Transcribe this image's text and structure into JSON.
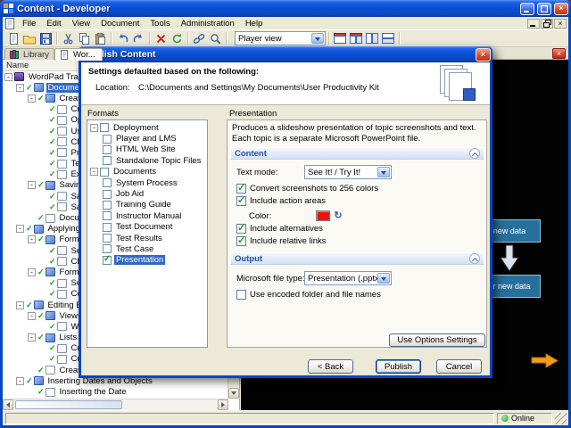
{
  "window": {
    "title": "Content - Developer",
    "titlebar_buttons": {
      "minimize": "minimize",
      "maximize": "maximize",
      "close": "close"
    },
    "menu": [
      "File",
      "Edit",
      "View",
      "Document",
      "Tools",
      "Administration",
      "Help"
    ],
    "toolbar": {
      "items": [
        "new-document",
        "open",
        "save",
        "|",
        "cut",
        "copy",
        "paste",
        "|",
        "undo",
        "redo",
        "|",
        "delete",
        "refresh",
        "|",
        "link",
        "find",
        "|"
      ],
      "view_combo": "Player view",
      "view_buttons": [
        "layout-player",
        "layout-split",
        "layout-columns",
        "layout-rows"
      ]
    },
    "status": {
      "online_label": "Online"
    }
  },
  "library": {
    "tabs": [
      {
        "label": "Library",
        "active": false
      },
      {
        "label": "Wor...",
        "active": true
      }
    ],
    "column_header": "Name",
    "tree": [
      {
        "d": 0,
        "label": "WordPad Training",
        "icon": "book",
        "check": false,
        "parent": true,
        "sel": false
      },
      {
        "d": 1,
        "label": "Document Basics",
        "icon": "section",
        "check": true,
        "parent": true,
        "sel": true
      },
      {
        "d": 2,
        "label": "Creating Documents",
        "icon": "section",
        "check": true,
        "parent": true,
        "sel": false
      },
      {
        "d": 3,
        "label": "Creating a New Document",
        "icon": "topic",
        "check": true,
        "parent": false,
        "sel": false
      },
      {
        "d": 3,
        "label": "Opening a Document",
        "icon": "topic",
        "check": true,
        "parent": false,
        "sel": false
      },
      {
        "d": 3,
        "label": "Using Templates",
        "icon": "topic",
        "check": true,
        "parent": false,
        "sel": false
      },
      {
        "d": 3,
        "label": "Changing Views",
        "icon": "topic",
        "check": true,
        "parent": false,
        "sel": false
      },
      {
        "d": 3,
        "label": "Printing a Document",
        "icon": "topic",
        "check": true,
        "parent": false,
        "sel": false
      },
      {
        "d": 3,
        "label": "Templates",
        "icon": "topic",
        "check": true,
        "parent": false,
        "sel": false
      },
      {
        "d": 3,
        "label": "Exiting WordPad",
        "icon": "topic",
        "check": true,
        "parent": false,
        "sel": false
      },
      {
        "d": 2,
        "label": "Saving Documents",
        "icon": "section",
        "check": true,
        "parent": true,
        "sel": false
      },
      {
        "d": 3,
        "label": "Saving a Document",
        "icon": "topic",
        "check": true,
        "parent": false,
        "sel": false
      },
      {
        "d": 3,
        "label": "Saving in Text Format",
        "icon": "topic",
        "check": true,
        "parent": false,
        "sel": false
      },
      {
        "d": 2,
        "label": "Document Properties",
        "icon": "topic",
        "check": true,
        "parent": false,
        "sel": false
      },
      {
        "d": 1,
        "label": "Applying Formatting",
        "icon": "section",
        "check": true,
        "parent": true,
        "sel": false
      },
      {
        "d": 2,
        "label": "Formatting Text",
        "icon": "section",
        "check": true,
        "parent": true,
        "sel": false
      },
      {
        "d": 3,
        "label": "Selecting Text",
        "icon": "topic",
        "check": true,
        "parent": false,
        "sel": false
      },
      {
        "d": 3,
        "label": "Changing Fonts",
        "icon": "topic",
        "check": true,
        "parent": false,
        "sel": false
      },
      {
        "d": 2,
        "label": "Formatting Paragraphs",
        "icon": "section",
        "check": true,
        "parent": true,
        "sel": false
      },
      {
        "d": 3,
        "label": "Selecting Paragraphs",
        "icon": "topic",
        "check": true,
        "parent": false,
        "sel": false
      },
      {
        "d": 3,
        "label": "Centering Text",
        "icon": "topic",
        "check": true,
        "parent": false,
        "sel": false
      },
      {
        "d": 1,
        "label": "Editing Basics",
        "icon": "section",
        "check": true,
        "parent": true,
        "sel": false
      },
      {
        "d": 2,
        "label": "Views and Toolbars",
        "icon": "section",
        "check": true,
        "parent": true,
        "sel": false
      },
      {
        "d": 3,
        "label": "Working with Views",
        "icon": "topic",
        "check": true,
        "parent": false,
        "sel": false
      },
      {
        "d": 2,
        "label": "Lists",
        "icon": "section",
        "check": true,
        "parent": true,
        "sel": false
      },
      {
        "d": 3,
        "label": "Creating Bullet Lists",
        "icon": "topic",
        "check": true,
        "parent": false,
        "sel": false
      },
      {
        "d": 3,
        "label": "Creating Lists",
        "icon": "topic",
        "check": true,
        "parent": false,
        "sel": false
      },
      {
        "d": 2,
        "label": "Creating Number Lists",
        "icon": "topic",
        "check": true,
        "parent": false,
        "sel": false
      },
      {
        "d": 1,
        "label": "Inserting Dates and Objects",
        "icon": "section",
        "check": true,
        "parent": true,
        "sel": false
      },
      {
        "d": 2,
        "label": "Inserting the Date",
        "icon": "topic",
        "check": true,
        "parent": false,
        "sel": false
      }
    ]
  },
  "canvas": {
    "boxes": [
      {
        "label": "new data"
      },
      {
        "label": "er new data"
      }
    ]
  },
  "dialog": {
    "title": "Publish Content",
    "header": {
      "intro": "Settings defaulted based on the following:",
      "location_label": "Location:",
      "location_value": "C:\\Documents and Settings\\My Documents\\User Productivity Kit"
    },
    "formats_label": "Formats",
    "formats": {
      "items": [
        {
          "d": 0,
          "label": "Deployment",
          "checked": false,
          "parent": true,
          "selected": false
        },
        {
          "d": 1,
          "label": "Player and LMS",
          "checked": false,
          "parent": false,
          "selected": false
        },
        {
          "d": 1,
          "label": "HTML Web Site",
          "checked": false,
          "parent": false,
          "selected": false
        },
        {
          "d": 1,
          "label": "Standalone Topic Files",
          "checked": false,
          "parent": false,
          "selected": false
        },
        {
          "d": 0,
          "label": "Documents",
          "checked": false,
          "parent": true,
          "selected": false
        },
        {
          "d": 1,
          "label": "System Process",
          "checked": false,
          "parent": false,
          "selected": false
        },
        {
          "d": 1,
          "label": "Job Aid",
          "checked": false,
          "parent": false,
          "selected": false
        },
        {
          "d": 1,
          "label": "Training Guide",
          "checked": false,
          "parent": false,
          "selected": false
        },
        {
          "d": 1,
          "label": "Instructor Manual",
          "checked": false,
          "parent": false,
          "selected": false
        },
        {
          "d": 1,
          "label": "Test Document",
          "checked": false,
          "parent": false,
          "selected": false
        },
        {
          "d": 1,
          "label": "Test Results",
          "checked": false,
          "parent": false,
          "selected": false
        },
        {
          "d": 1,
          "label": "Test Case",
          "checked": false,
          "parent": false,
          "selected": false
        },
        {
          "d": 1,
          "label": "Presentation",
          "checked": true,
          "parent": false,
          "selected": true
        }
      ]
    },
    "preview_label": "Presentation",
    "description": "Produces a slideshow presentation of topic screenshots and text.  Each topic is a separate Microsoft PowerPoint file.",
    "content": {
      "title": "Content",
      "text_mode_label": "Text mode:",
      "text_mode_value": "See It! / Try It!",
      "checks": [
        {
          "label": "Convert screenshots to 256 colors",
          "checked": true
        },
        {
          "label": "Include action areas",
          "checked": true
        },
        {
          "label": "Include alternatives",
          "checked": true
        },
        {
          "label": "Include relative links",
          "checked": true
        }
      ],
      "color_label": "Color:",
      "color_value": "#EE1111"
    },
    "output": {
      "title": "Output",
      "file_type_label": "Microsoft file type:",
      "file_type_value": "Presentation (.pptx)",
      "check": {
        "label": "Use encoded folder and file names",
        "checked": false
      }
    },
    "options_button": "Use Options Settings",
    "buttons": {
      "back": "< Back",
      "publish": "Publish",
      "cancel": "Cancel"
    }
  }
}
